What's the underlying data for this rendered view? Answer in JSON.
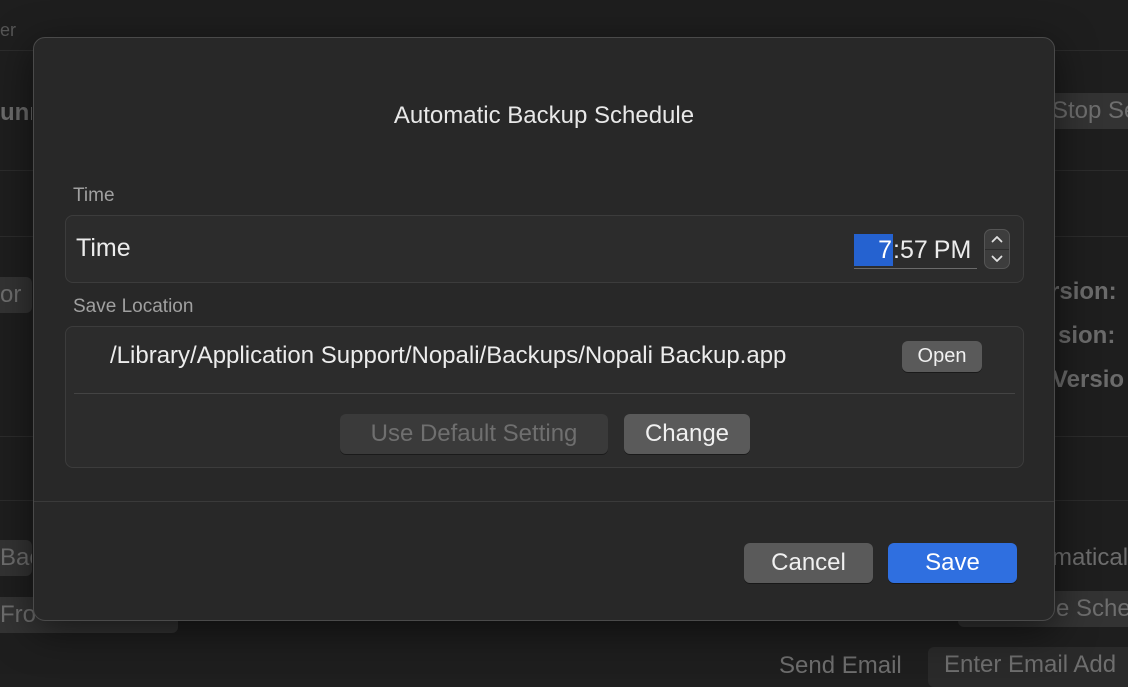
{
  "background": {
    "fragments": {
      "top_left": "er",
      "left1": "unn",
      "left2": "or",
      "left3": "Bac",
      "left4": "Fro",
      "right1": "Stop Se",
      "right2": "rsion:",
      "right3": "sion:",
      "right4": "Versio",
      "right5": "matical",
      "right6": "e Sche",
      "send_email": "Send Email",
      "email_placeholder": "Enter Email Add"
    }
  },
  "dialog": {
    "title": "Automatic Backup Schedule",
    "time_section": {
      "section_label": "Time",
      "row_label": "Time",
      "hour": "7",
      "minute": "57",
      "ampm": "PM"
    },
    "save_section": {
      "section_label": "Save Location",
      "path": "/Library/Application Support/Nopali/Backups/Nopali Backup.app",
      "open_label": "Open",
      "default_label": "Use Default Setting",
      "change_label": "Change"
    },
    "cancel_label": "Cancel",
    "save_label": "Save"
  },
  "colors": {
    "accent": "#2f6fe0",
    "selection": "#2562d0",
    "dialog_bg": "#282828"
  }
}
